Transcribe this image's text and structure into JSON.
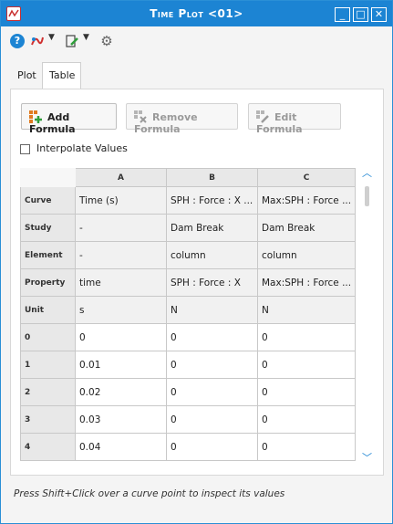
{
  "window": {
    "title": "Time Plot <01>",
    "controls": [
      "_",
      "□",
      "✕"
    ]
  },
  "toolbar": {
    "help_icon": "help-icon",
    "curve_icon": "curve-tool-icon",
    "edit_icon": "edit-tool-icon",
    "settings_icon": "gear-icon"
  },
  "tabs": [
    {
      "label": "Plot",
      "active": false
    },
    {
      "label": "Table",
      "active": true
    }
  ],
  "actions": {
    "add_formula": "Add Formula",
    "remove_formula": "Remove Formula",
    "edit_formula": "Edit Formula"
  },
  "interpolate": {
    "label": "Interpolate Values",
    "checked": false
  },
  "table": {
    "columns": [
      "A",
      "B",
      "C"
    ],
    "meta_rows": [
      {
        "head": "Curve",
        "cells": [
          "Time (s)",
          "SPH : Force : X ...",
          "Max:SPH : Force ..."
        ]
      },
      {
        "head": "Study",
        "cells": [
          "-",
          "Dam Break",
          "Dam Break"
        ]
      },
      {
        "head": "Element",
        "cells": [
          "-",
          "column",
          "column"
        ]
      },
      {
        "head": "Property",
        "cells": [
          "time",
          "SPH : Force : X",
          "Max:SPH : Force ..."
        ]
      },
      {
        "head": "Unit",
        "cells": [
          "s",
          "N",
          "N"
        ]
      }
    ],
    "data_rows": [
      {
        "head": "0",
        "cells": [
          "0",
          "0",
          "0"
        ]
      },
      {
        "head": "1",
        "cells": [
          "0.01",
          "0",
          "0"
        ]
      },
      {
        "head": "2",
        "cells": [
          "0.02",
          "0",
          "0"
        ]
      },
      {
        "head": "3",
        "cells": [
          "0.03",
          "0",
          "0"
        ]
      },
      {
        "head": "4",
        "cells": [
          "0.04",
          "0",
          "0"
        ]
      }
    ]
  },
  "status": "Press Shift+Click over a curve point to inspect its values",
  "colors": {
    "titlebar": "#1c84d3",
    "accent": "#1c84d3"
  }
}
